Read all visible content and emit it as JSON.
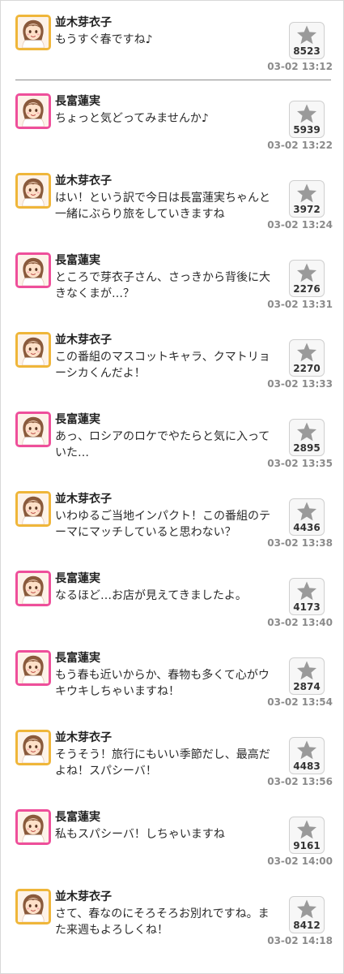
{
  "posts": [
    {
      "avatar": "namiki-meiko-avatar",
      "frame": "gold",
      "name": "並木芽衣子",
      "text": "もうすぐ春ですね♪",
      "favorites": "8523",
      "time": "03-02 13:12"
    },
    {
      "avatar": "nagatomi-hasumi-avatar",
      "frame": "pink",
      "name": "長富蓮実",
      "text": "ちょっと気どってみませんか♪",
      "favorites": "5939",
      "time": "03-02 13:22"
    },
    {
      "avatar": "namiki-meiko-avatar",
      "frame": "gold",
      "name": "並木芽衣子",
      "text": "はい！という訳で今日は長富蓮実ちゃんと一緒にぶらり旅をしていきますね",
      "favorites": "3972",
      "time": "03-02 13:24"
    },
    {
      "avatar": "nagatomi-hasumi-avatar",
      "frame": "pink",
      "name": "長富蓮実",
      "text": "ところで芽衣子さん、さっきから背後に大きなくまが…？",
      "favorites": "2276",
      "time": "03-02 13:31"
    },
    {
      "avatar": "namiki-meiko-avatar",
      "frame": "gold",
      "name": "並木芽衣子",
      "text": "この番組のマスコットキャラ、クマトリョーシカくんだよ！",
      "favorites": "2270",
      "time": "03-02 13:33"
    },
    {
      "avatar": "nagatomi-hasumi-avatar",
      "frame": "pink",
      "name": "長富蓮実",
      "text": "あっ、ロシアのロケでやたらと気に入っていた…",
      "favorites": "2895",
      "time": "03-02 13:35"
    },
    {
      "avatar": "namiki-meiko-avatar",
      "frame": "gold",
      "name": "並木芽衣子",
      "text": "いわゆるご当地インパクト！この番組のテーマにマッチしていると思わない？",
      "favorites": "4436",
      "time": "03-02 13:38"
    },
    {
      "avatar": "nagatomi-hasumi-avatar",
      "frame": "pink",
      "name": "長富蓮実",
      "text": "なるほど…お店が見えてきましたよ。",
      "favorites": "4173",
      "time": "03-02 13:40"
    },
    {
      "avatar": "nagatomi-hasumi-avatar",
      "frame": "pink",
      "name": "長富蓮実",
      "text": "もう春も近いからか、春物も多くて心がウキウキしちゃいますね！",
      "favorites": "2874",
      "time": "03-02 13:54"
    },
    {
      "avatar": "namiki-meiko-avatar",
      "frame": "gold",
      "name": "並木芽衣子",
      "text": "そうそう！旅行にもいい季節だし、最高だよね！スパシーバ！",
      "favorites": "4483",
      "time": "03-02 13:56"
    },
    {
      "avatar": "nagatomi-hasumi-avatar",
      "frame": "pink",
      "name": "長富蓮実",
      "text": "私もスパシーバ！しちゃいますね",
      "favorites": "9161",
      "time": "03-02 14:00"
    },
    {
      "avatar": "namiki-meiko-avatar",
      "frame": "gold",
      "name": "並木芽衣子",
      "text": "さて、春なのにそろそろお別れですね。また来週もよろしくね！",
      "favorites": "8412",
      "time": "03-02 14:18"
    }
  ],
  "icons": {
    "favorite": "star-icon"
  },
  "colors": {
    "pink_frame": "#ee4f9b",
    "gold_frame": "#efb63a",
    "timestamp": "#8b8b8b",
    "star": "#9a9a9a"
  }
}
